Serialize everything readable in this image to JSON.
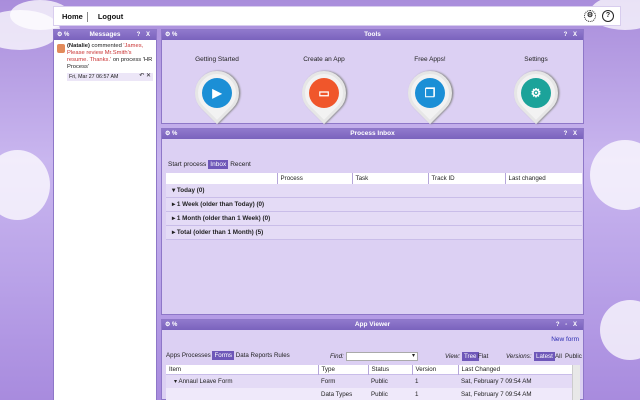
{
  "nav": {
    "home": "Home",
    "logout": "Logout"
  },
  "icons": {
    "settings": "gear-icon",
    "help": "help-icon"
  },
  "messages_panel": {
    "title": "Messages",
    "item": {
      "author": "(Natalie)",
      "verb": "commented",
      "quote": "'James, Please review Mr.Smith's resume. Thanks.'",
      "tail": "on process 'HR Process'",
      "time": "Fri, Mar 27 06:57 AM"
    }
  },
  "tools_panel": {
    "title": "Tools",
    "items": [
      {
        "label": "Getting Started",
        "color": "#1b8fd6"
      },
      {
        "label": "Create an App",
        "color": "#f0562b"
      },
      {
        "label": "Free Apps!",
        "color": "#1b8fd6"
      },
      {
        "label": "Settings",
        "color": "#1ba39a"
      }
    ]
  },
  "inbox_panel": {
    "title": "Process Inbox",
    "tabs": [
      "Start process",
      "Inbox",
      "Recent"
    ],
    "active_tab": "Inbox",
    "columns": [
      "Process",
      "Task",
      "Track ID",
      "Last changed"
    ],
    "groups": [
      "Today (0)",
      "1 Week (older than Today) (0)",
      "1 Month (older than 1 Week) (0)",
      "Total (older than 1 Month) (5)"
    ]
  },
  "viewer_panel": {
    "title": "App Viewer",
    "new_form": "New form",
    "tabs": [
      "Apps",
      "Processes",
      "Forms",
      "Data",
      "Reports",
      "Rules"
    ],
    "active_tab": "Forms",
    "find_label": "Find:",
    "view_label": "View:",
    "view_tree": "Tree",
    "view_flat": "Flat",
    "versions_label": "Versions:",
    "version_latest": "Latest",
    "version_all": "All",
    "version_public": "Public",
    "columns": [
      "Item",
      "Type",
      "Status",
      "Version",
      "Last Changed"
    ],
    "rows": [
      {
        "item": "Annaul Leave Form",
        "type": "Form",
        "status": "Public",
        "version": "1",
        "changed": "Sat, February 7 09:54 AM"
      },
      {
        "item": "",
        "type": "Data Types",
        "status": "Public",
        "version": "1",
        "changed": "Sat, February 7 09:54 AM"
      }
    ]
  }
}
